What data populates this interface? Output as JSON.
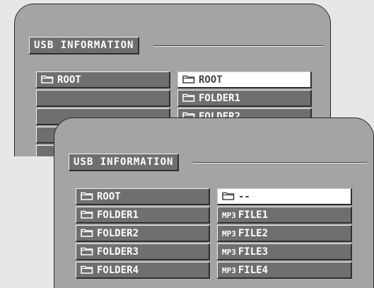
{
  "back_screen": {
    "title": "USB INFORMATION",
    "left_list": [
      {
        "icon": "folder-icon",
        "label": "ROOT"
      },
      {
        "icon": "",
        "label": ""
      },
      {
        "icon": "",
        "label": ""
      },
      {
        "icon": "",
        "label": ""
      },
      {
        "icon": "",
        "label": ""
      }
    ],
    "right_list": [
      {
        "icon": "folder-icon",
        "label": "ROOT",
        "selected": true
      },
      {
        "icon": "folder-icon",
        "label": "FOLDER1"
      },
      {
        "icon": "folder-icon",
        "label": "FOLDER2"
      }
    ]
  },
  "front_screen": {
    "title": "USB INFORMATION",
    "left_list": [
      {
        "icon": "folder-icon",
        "label": "ROOT"
      },
      {
        "icon": "folder-icon",
        "label": "FOLDER1"
      },
      {
        "icon": "folder-icon",
        "label": "FOLDER2"
      },
      {
        "icon": "folder-icon",
        "label": "FOLDER3"
      },
      {
        "icon": "folder-icon",
        "label": "FOLDER4"
      }
    ],
    "right_list": [
      {
        "icon": "folder-icon",
        "tag": "",
        "label": "--",
        "selected": true
      },
      {
        "icon": "",
        "tag": "MP3",
        "label": "FILE1"
      },
      {
        "icon": "",
        "tag": "MP3",
        "label": "FILE2"
      },
      {
        "icon": "",
        "tag": "MP3",
        "label": "FILE3"
      },
      {
        "icon": "",
        "tag": "MP3",
        "label": "FILE4"
      }
    ]
  },
  "colors": {
    "screen_bg": "#a4a4a4",
    "row_bg": "#6f6f6f",
    "row_selected_bg": "#ffffff",
    "page_bg": "#e7e7e7"
  }
}
